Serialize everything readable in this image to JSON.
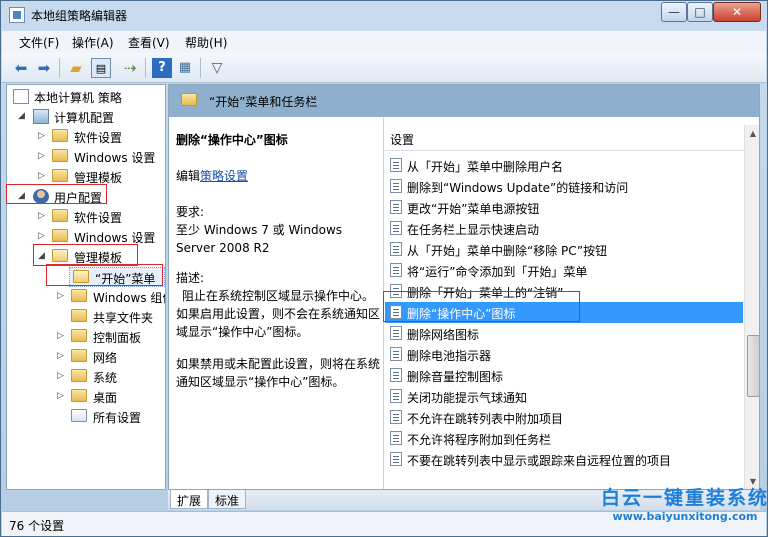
{
  "window": {
    "title": "本地组策略编辑器"
  },
  "menu": [
    "文件(F)",
    "操作(A)",
    "查看(V)",
    "帮助(H)"
  ],
  "toolbar": [
    "back-arrow-icon",
    "forward-arrow-icon",
    "up-folder-icon",
    "show-hide-tree-icon",
    "export-icon",
    "help-icon",
    "properties-icon",
    "filter-icon"
  ],
  "tree": {
    "root": "本地计算机 策略",
    "items": [
      {
        "label": "计算机配置"
      },
      {
        "label": "软件设置"
      },
      {
        "label": "Windows 设置"
      },
      {
        "label": "管理模板"
      },
      {
        "label": "用户配置"
      },
      {
        "label": "软件设置"
      },
      {
        "label": "Windows 设置"
      },
      {
        "label": "管理模板"
      },
      {
        "label": "“开始”菜单"
      },
      {
        "label": "Windows 组件"
      },
      {
        "label": "共享文件夹"
      },
      {
        "label": "控制面板"
      },
      {
        "label": "网络"
      },
      {
        "label": "系统"
      },
      {
        "label": "桌面"
      },
      {
        "label": "所有设置"
      }
    ]
  },
  "main": {
    "header_title": "“开始”菜单和任务栏",
    "desc_title": "删除“操作中心”图标",
    "edit_prefix": "编辑",
    "edit_link": "策略设置",
    "requirement_label": "要求:",
    "requirement_line1": "至少 Windows 7 或 Windows",
    "requirement_line2": "Server 2008 R2",
    "description_label": "描述:",
    "description_p1": "阻止在系统控制区域显示操作中心。如果启用此设置，则不会在系统通知区域显示“操作中心”图标。",
    "description_p2": "如果禁用或未配置此设置，则将在系统通知区域显示“操作中心”图标。",
    "list_header": "设置",
    "list_items": [
      "从「开始」菜单中删除用户名",
      "删除到“Windows Update”的链接和访问",
      "更改“开始”菜单电源按钮",
      "在任务栏上显示快速启动",
      "从「开始」菜单中删除“移除 PC”按钮",
      "将“运行”命令添加到「开始」菜单",
      "删除「开始」菜单上的“注销”",
      "删除“操作中心”图标",
      "删除网络图标",
      "删除电池指示器",
      "删除音量控制图标",
      "关闭功能提示气球通知",
      "不允许在跳转列表中附加项目",
      "不允许将程序附加到任务栏",
      "不要在跳转列表中显示或跟踪来自远程位置的项目"
    ],
    "selected_index": 7
  },
  "tabs": [
    "扩展",
    "标准"
  ],
  "status": "76 个设置",
  "watermark": {
    "text": "白云一键重装系统",
    "url": "www.baiyunxitong.com"
  },
  "colors": {
    "selection": "#3399ff",
    "highlight_box": "#e0262b",
    "header_band": "#8fb0cd"
  }
}
